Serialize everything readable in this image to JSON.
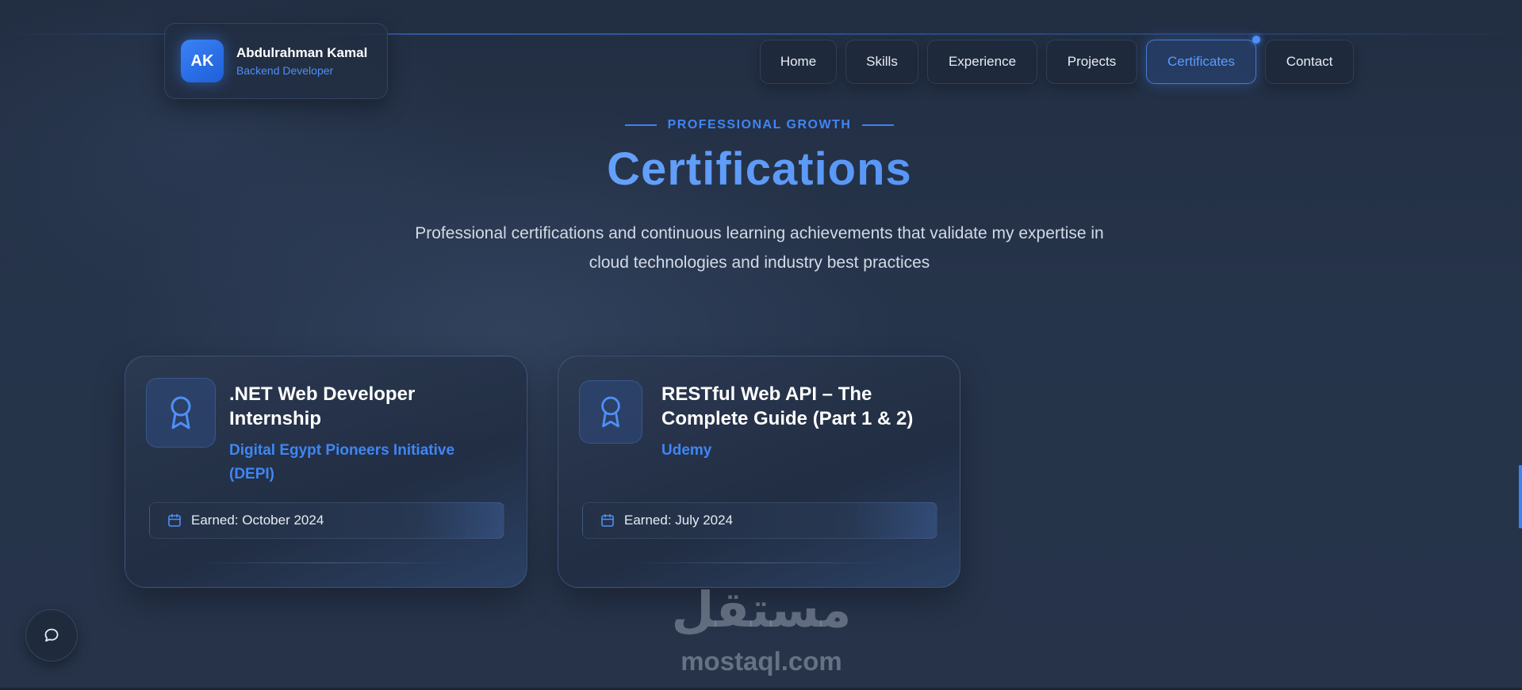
{
  "brand": {
    "initials": "AK",
    "name": "Abdulrahman Kamal",
    "role": "Backend Developer"
  },
  "nav": {
    "items": [
      {
        "label": "Home"
      },
      {
        "label": "Skills"
      },
      {
        "label": "Experience"
      },
      {
        "label": "Projects"
      },
      {
        "label": "Certificates"
      },
      {
        "label": "Contact"
      }
    ],
    "active": "Certificates"
  },
  "section": {
    "eyebrow": "PROFESSIONAL GROWTH",
    "title": "Certifications",
    "subtitle_line1": "Professional certifications and continuous learning achievements that validate my expertise in",
    "subtitle_line2": "cloud technologies and industry best practices"
  },
  "certificates": [
    {
      "title_line1": ".NET Web Developer",
      "title_line2": "Internship",
      "issuer_line1": "Digital Egypt Pioneers Initiative",
      "issuer_line2": "(DEPI)",
      "earned": "Earned: October 2024",
      "icon": "award-icon"
    },
    {
      "title_line1": "RESTful Web API – The",
      "title_line2": "Complete Guide (Part 1 & 2)",
      "issuer_line1": "Udemy",
      "issuer_line2": "",
      "earned": "Earned: July 2024",
      "icon": "award-icon"
    }
  ],
  "chat": {
    "icon": "chat-bubble-icon"
  },
  "watermark": {
    "arabic": "مستقل",
    "latin": "mostaql.com"
  },
  "colors": {
    "accent": "#3b82f6",
    "background": "#253349",
    "card": "#2c3a52"
  }
}
